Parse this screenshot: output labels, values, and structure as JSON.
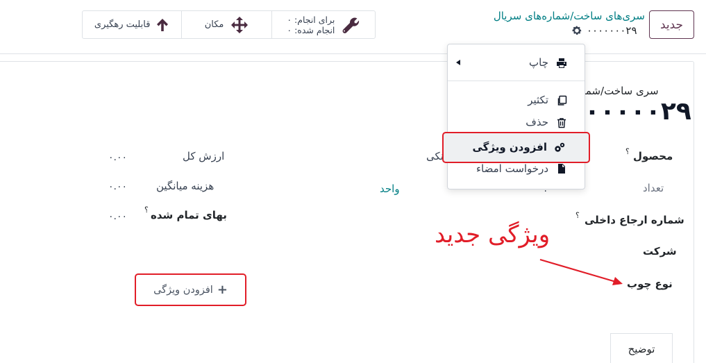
{
  "topbar": {
    "new_button": "جدید",
    "breadcrumb": "سری‌های ساخت/شماره‌های سریال",
    "record_name": "۰۰۰۰۰۰۰۲۹",
    "smart_buttons": {
      "traceability": "قابلیت رهگیری",
      "location": "مکان",
      "to_do": "برای انجام: ۰",
      "done": "انجام شده: ۰"
    }
  },
  "menu": {
    "print": "چاپ",
    "duplicate": "تکثیر",
    "delete": "حذف",
    "add_property": "افزودن ویژگی",
    "request_signature": "درخواست امضاء"
  },
  "form": {
    "lot_label": "سری ساخت/شمار",
    "lot_value": "۰۰۰۰۰۲۹",
    "product_label": "محصول",
    "product_value_fragment": "نکی",
    "quantity_label": "تعداد",
    "quantity_value_fragment": "۰.۰۰",
    "unit": "واحد",
    "internal_ref_label": "شماره ارجاع داخلی",
    "company_label": "شرکت",
    "wood_type_label": "نوع چوب",
    "total_value_label": "ارزش کل",
    "total_value": "۰.۰۰",
    "avg_cost_label": "هزینه میانگین",
    "avg_cost": "۰.۰۰",
    "landed_cost_label": "بهای تمام شده",
    "landed_cost": "۰.۰۰",
    "help_mark": "؟",
    "add_property_link": "افزودن ویژگی",
    "description_tab": "توضیح"
  },
  "annotation": {
    "text": "ویژگی جدید",
    "color": "#e11d28"
  },
  "colors": {
    "brand": "#5f3450",
    "link": "#017e84",
    "highlight_border": "#e11d28"
  }
}
